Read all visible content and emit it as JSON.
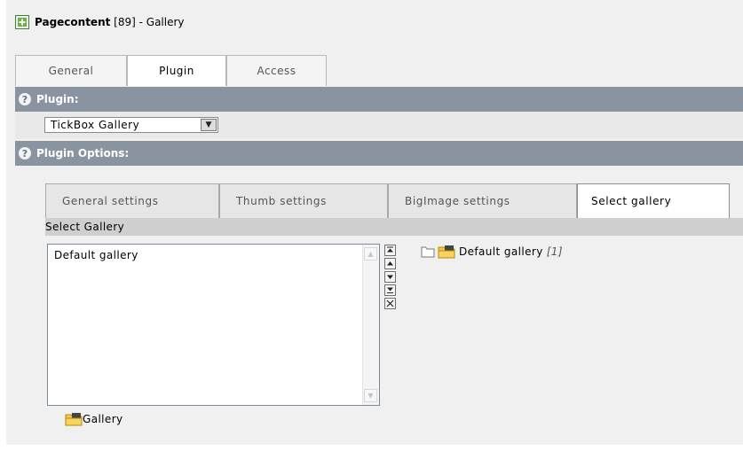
{
  "header": {
    "title_bold": "Pagecontent",
    "title_rest": " [89] - Gallery",
    "icon": "page-add-icon"
  },
  "tabs": [
    {
      "label": "General",
      "active": false
    },
    {
      "label": "Plugin",
      "active": true
    },
    {
      "label": "Access",
      "active": false
    }
  ],
  "plugin_section": {
    "help_icon": "?",
    "heading": "Plugin:",
    "select_value": "TickBox Gallery"
  },
  "options_section": {
    "help_icon": "?",
    "heading": "Plugin Options:"
  },
  "subtabs": [
    {
      "label": "General settings",
      "active": false
    },
    {
      "label": "Thumb settings",
      "active": false
    },
    {
      "label": "BigImage settings",
      "active": false
    },
    {
      "label": "Select gallery",
      "active": true
    }
  ],
  "select_gallery": {
    "header": "Select Gallery",
    "list_items": [
      "Default gallery"
    ],
    "tree_item": {
      "label": "Default gallery",
      "count": "[1]"
    },
    "footer_label": "Gallery"
  },
  "colors": {
    "section_bar": "#8a94a0",
    "panel_bg": "#f0f0f0",
    "folder_yellow": "#f2c94c"
  }
}
